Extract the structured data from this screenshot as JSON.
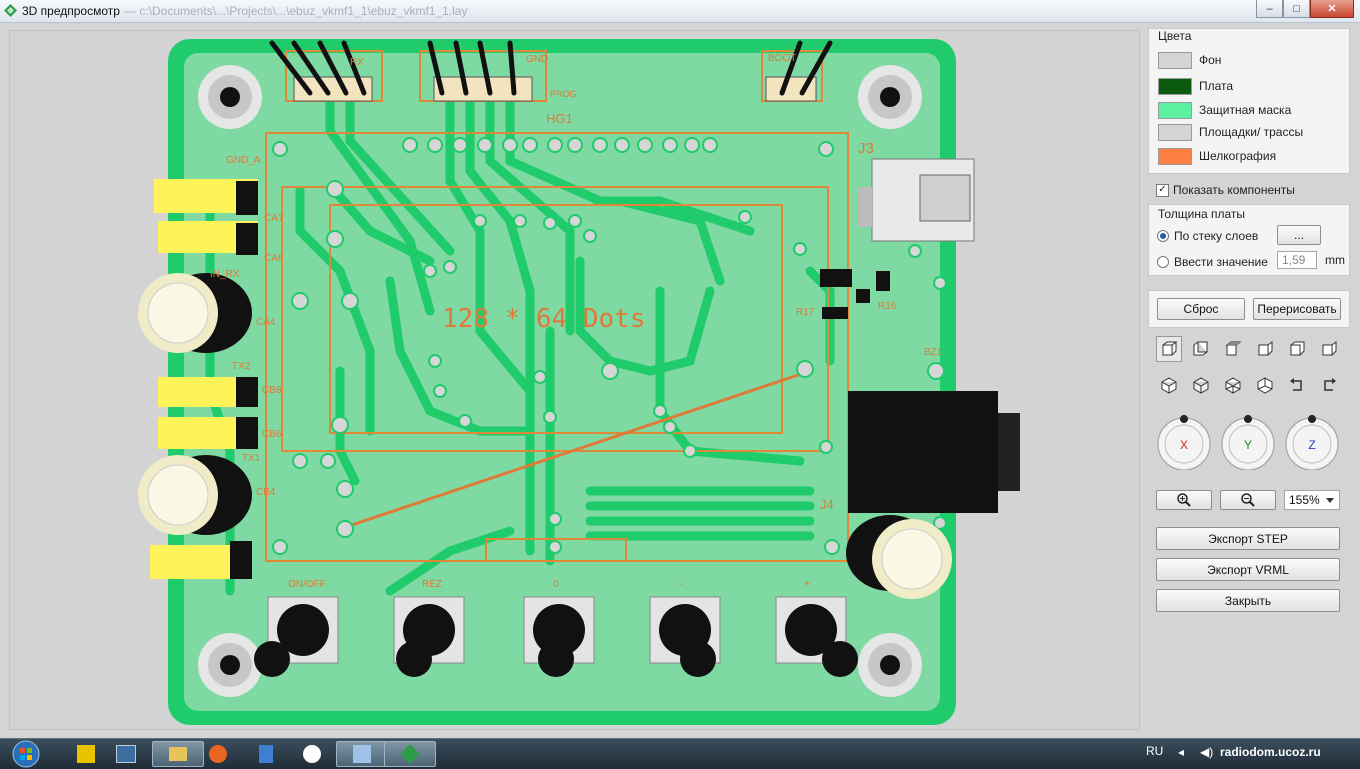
{
  "window": {
    "title": "3D предпросмотр",
    "path": "— c:\\Documents\\...\\Projects\\...\\ebuz_vkmf1_1\\ebuz_vkmf1_1.lay",
    "buttons": {
      "minimize": "–",
      "maximize": "□",
      "close": "✕"
    }
  },
  "board": {
    "labels": {
      "rx": "RX",
      "gnd": "GND",
      "prog": "PROG",
      "boot": "BOOT",
      "hg1": "HG1",
      "j3": "J3",
      "j4": "J4",
      "gnd_a": "GND_A",
      "ca7": "CA7",
      "ca8": "CA8",
      "in_rx": "IN_RX",
      "ca4": "CA4",
      "tx2": "TX2",
      "cb8": "CB8",
      "cb6": "CB6",
      "tx1": "TX1",
      "cb4": "CB4",
      "r17": "R17",
      "r16": "R16",
      "bz1": "BZ1",
      "dots": "128 * 64 Dots",
      "on_off": "ON/OFF",
      "rez": "REZ",
      "zero": "0",
      "minus": "-",
      "plus": "+"
    }
  },
  "panel": {
    "colors_title": "Цвета",
    "colors": [
      {
        "label": "Фон",
        "color": "#d4d4d4"
      },
      {
        "label": "Плата",
        "color": "#0b5a10"
      },
      {
        "label": "Защитная маска",
        "color": "#5cf0a0"
      },
      {
        "label": "Площадки/ трассы",
        "color": "#d4d4d4"
      },
      {
        "label": "Шелкография",
        "color": "#ff8040"
      }
    ],
    "show_components": "Показать компоненты",
    "thickness_title": "Толщина платы",
    "by_stack": "По стеку слоев",
    "stack_button": "...",
    "enter_value": "Ввести значение",
    "thickness_value": "1,59",
    "unit": "mm",
    "reset": "Сброс",
    "redraw": "Перерисовать",
    "axes": {
      "x": "X",
      "y": "Y",
      "z": "Z"
    },
    "zoom": "155%",
    "export_step": "Экспорт STEP",
    "export_vrml": "Экспорт VRML",
    "close": "Закрыть"
  },
  "taskbar": {
    "lang": "RU",
    "site": "radiodom.ucoz.ru"
  }
}
